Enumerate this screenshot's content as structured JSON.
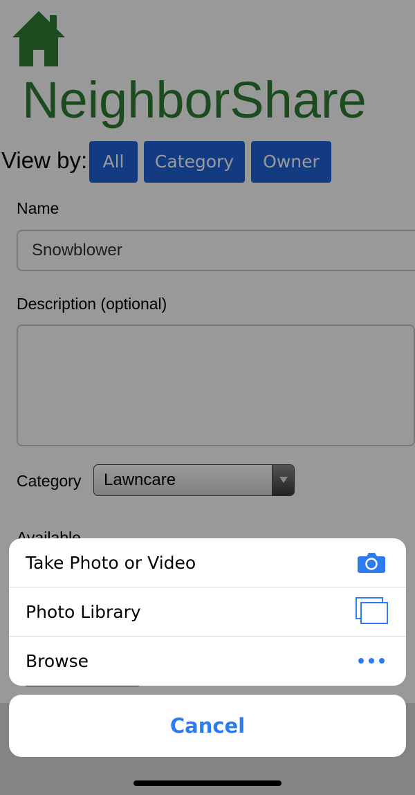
{
  "app": {
    "title": "NeighborShare",
    "home_icon": "house-icon",
    "brand_color": "#2e7d32"
  },
  "view_by": {
    "label": "View by:",
    "buttons": [
      "All",
      "Category",
      "Owner"
    ],
    "button_color": "#1f63d9"
  },
  "form": {
    "name_label": "Name",
    "name_value": "Snowblower",
    "description_label": "Description (optional)",
    "description_value": "",
    "category_label": "Category",
    "category_value": "Lawncare",
    "available_label": "Available"
  },
  "action_sheet": {
    "items": [
      {
        "label": "Take Photo or Video",
        "icon": "camera-icon"
      },
      {
        "label": "Photo Library",
        "icon": "photo-library-icon"
      },
      {
        "label": "Browse",
        "icon": "more-icon"
      }
    ],
    "cancel_label": "Cancel",
    "accent_color": "#2c7bf0"
  }
}
